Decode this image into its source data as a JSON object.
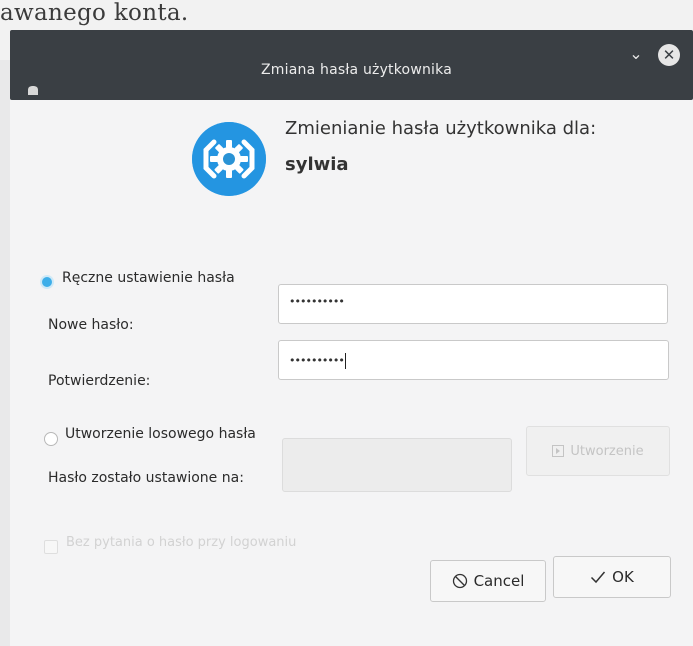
{
  "background": {
    "text": "awanego konta."
  },
  "titlebar": {
    "title": "Zmiana hasła użytkownika",
    "minimize_glyph": "⌄",
    "close_glyph": "✕"
  },
  "header": {
    "heading": "Zmienianie hasła użytkownika dla:",
    "username": "sylwia"
  },
  "manual": {
    "radio_label": "Ręczne ustawienie hasła",
    "new_password_label": "Nowe hasło:",
    "new_password_value": "••••••••••",
    "confirm_label": "Potwierdzenie:",
    "confirm_value": "••••••••••"
  },
  "random": {
    "radio_label": "Utworzenie losowego hasła",
    "set_to_label": "Hasło zostało ustawione na:",
    "generate_button": "Utworzenie"
  },
  "no_password_login_label": "Bez pytania o hasło przy logowaniu",
  "buttons": {
    "cancel": "Cancel",
    "ok": "OK"
  },
  "colors": {
    "accent": "#3daee9",
    "titlebar": "#3a3f44"
  }
}
